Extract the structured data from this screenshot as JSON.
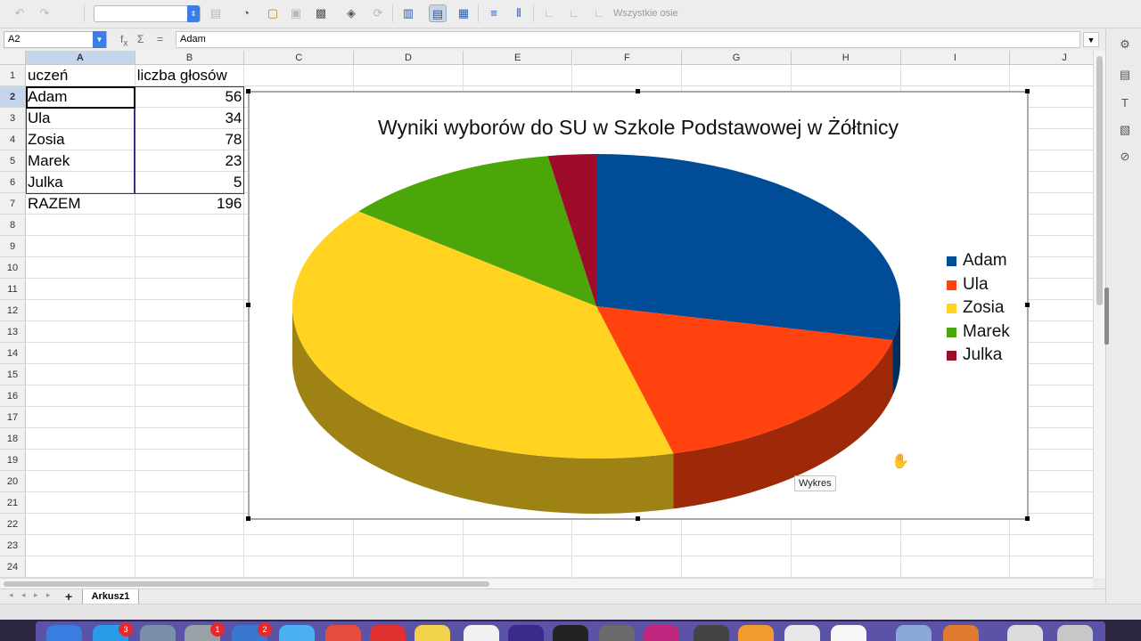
{
  "toolbar": {
    "axes_label": "Wszystkie osie",
    "chart_element_value": ""
  },
  "formula_bar": {
    "cell_ref": "A2",
    "content": "Adam"
  },
  "sheet": {
    "columns": [
      "A",
      "B",
      "C",
      "D",
      "E",
      "F",
      "G",
      "H",
      "I",
      "J"
    ],
    "rows": [
      "1",
      "2",
      "3",
      "4",
      "5",
      "6",
      "7",
      "8",
      "9",
      "10",
      "11",
      "12",
      "13",
      "14",
      "15",
      "16",
      "17",
      "18",
      "19",
      "20",
      "21",
      "22",
      "23",
      "24"
    ],
    "header_a": "uczeń",
    "header_b": "liczba głosów",
    "data": [
      {
        "name": "Adam",
        "votes": "56"
      },
      {
        "name": "Ula",
        "votes": "34"
      },
      {
        "name": "Zosia",
        "votes": "78"
      },
      {
        "name": "Marek",
        "votes": "23"
      },
      {
        "name": "Julka",
        "votes": "5"
      }
    ],
    "total_label": "RAZEM",
    "total_value": "196"
  },
  "chart": {
    "tooltip": "Wykres"
  },
  "chart_data": {
    "type": "pie",
    "title": "Wyniki wyborów do SU w Szkole Podstawowej w Żółtnicy",
    "categories": [
      "Adam",
      "Ula",
      "Zosia",
      "Marek",
      "Julka"
    ],
    "values": [
      56,
      34,
      78,
      23,
      5
    ],
    "colors": [
      "#004c97",
      "#ff420e",
      "#ffd320",
      "#4ba60a",
      "#9e0c2a"
    ],
    "legend_position": "right",
    "3d": true
  },
  "tabs": {
    "active": "Arkusz1",
    "add_label": "+"
  },
  "dock": {
    "badges": [
      "3",
      "1",
      "2"
    ]
  }
}
